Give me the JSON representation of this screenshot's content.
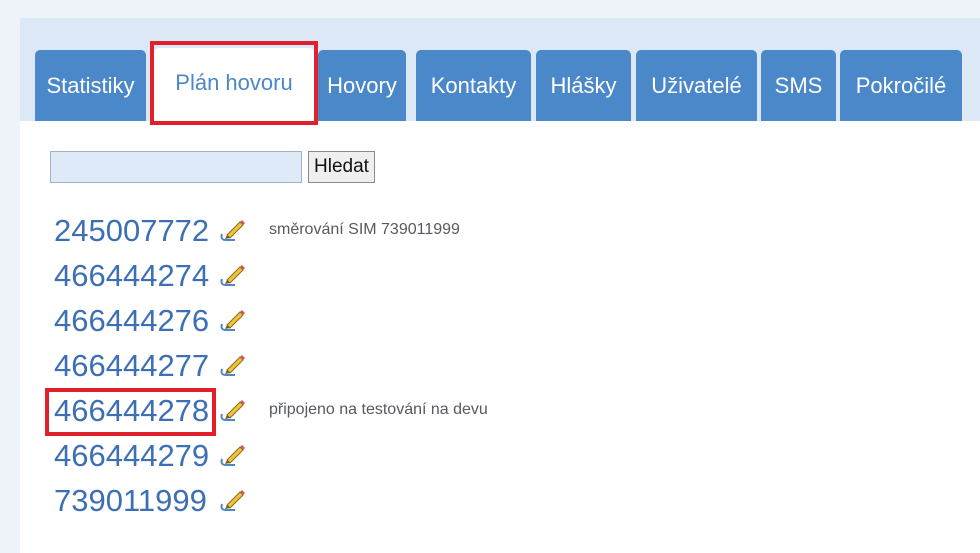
{
  "tabs": [
    {
      "label": "Statistiky"
    },
    {
      "label": "Plán hovoru"
    },
    {
      "label": "Hovory"
    },
    {
      "label": "Kontakty"
    },
    {
      "label": "Hlášky"
    },
    {
      "label": "Uživatelé"
    },
    {
      "label": "SMS"
    },
    {
      "label": "Pokročilé"
    }
  ],
  "active_tab": "Plán hovoru",
  "search": {
    "value": "",
    "placeholder": "",
    "button_label": "Hledat"
  },
  "numbers": [
    {
      "number": "245007772",
      "note": "směrování SIM 739011999"
    },
    {
      "number": "466444274",
      "note": ""
    },
    {
      "number": "466444276",
      "note": ""
    },
    {
      "number": "466444277",
      "note": ""
    },
    {
      "number": "466444278",
      "note": "připojeno na testování na devu"
    },
    {
      "number": "466444279",
      "note": ""
    },
    {
      "number": "739011999",
      "note": ""
    }
  ],
  "icons": {
    "edit": "edit-pencil-icon"
  },
  "colors": {
    "tab_bg": "#4a88c9",
    "tabbar_bg": "#dce8f6",
    "link": "#3d6fb5",
    "highlight": "#e0202a"
  }
}
